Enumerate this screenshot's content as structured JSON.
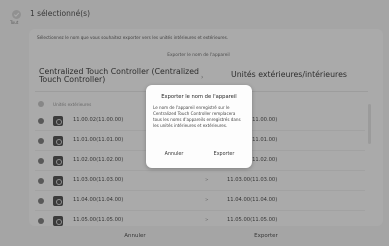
{
  "header": {
    "selected_count": "1 sélectionné(s)",
    "select_all_label": "Tout"
  },
  "card": {
    "instruction": "Sélectionnez le nom que vous souhaitez exporter vers les unités intérieures et extérieures.",
    "export_name_label": "Exporter le nom de l'appareil",
    "source_name": "Centralized Touch Controller (Centralized Touch Controller)",
    "target_name": "Unités extérieures/intérieures",
    "units_header": "Unités extérieures",
    "rows": [
      {
        "src": "11.00.02(11.00.00)",
        "tgt": "11.00.02(11.00.00)"
      },
      {
        "src": "11.01.00(11.01.00)",
        "tgt": "11.01.00(11.01.00)"
      },
      {
        "src": "11.02.00(11.02.00)",
        "tgt": "11.02.00(11.02.00)"
      },
      {
        "src": "11.03.00(11.03.00)",
        "tgt": "11.03.00(11.03.00)"
      },
      {
        "src": "11.04.00(11.04.00)",
        "tgt": "11.04.00(11.04.00)"
      },
      {
        "src": "11.05.00(11.05.00)",
        "tgt": "11.05.00(11.05.00)"
      }
    ],
    "row_separator": ">"
  },
  "bottom": {
    "cancel_label": "Annuler",
    "export_label": "Exporter"
  },
  "dialog": {
    "title": "Exporter le nom de l'appareil",
    "body": "Le nom de l'appareil enregistré sur le Centralized Touch Controller remplacera tous les noms d'appareils enregistrés dans les unités intérieures et extérieures.",
    "cancel_label": "Annuler",
    "export_label": "Exporter"
  },
  "colors": {
    "background": "#f2f2f2",
    "card": "#fafafa",
    "overlay": "#3c3c3c",
    "dialog": "#fdfdfd",
    "checked": "#6e6e6e"
  }
}
